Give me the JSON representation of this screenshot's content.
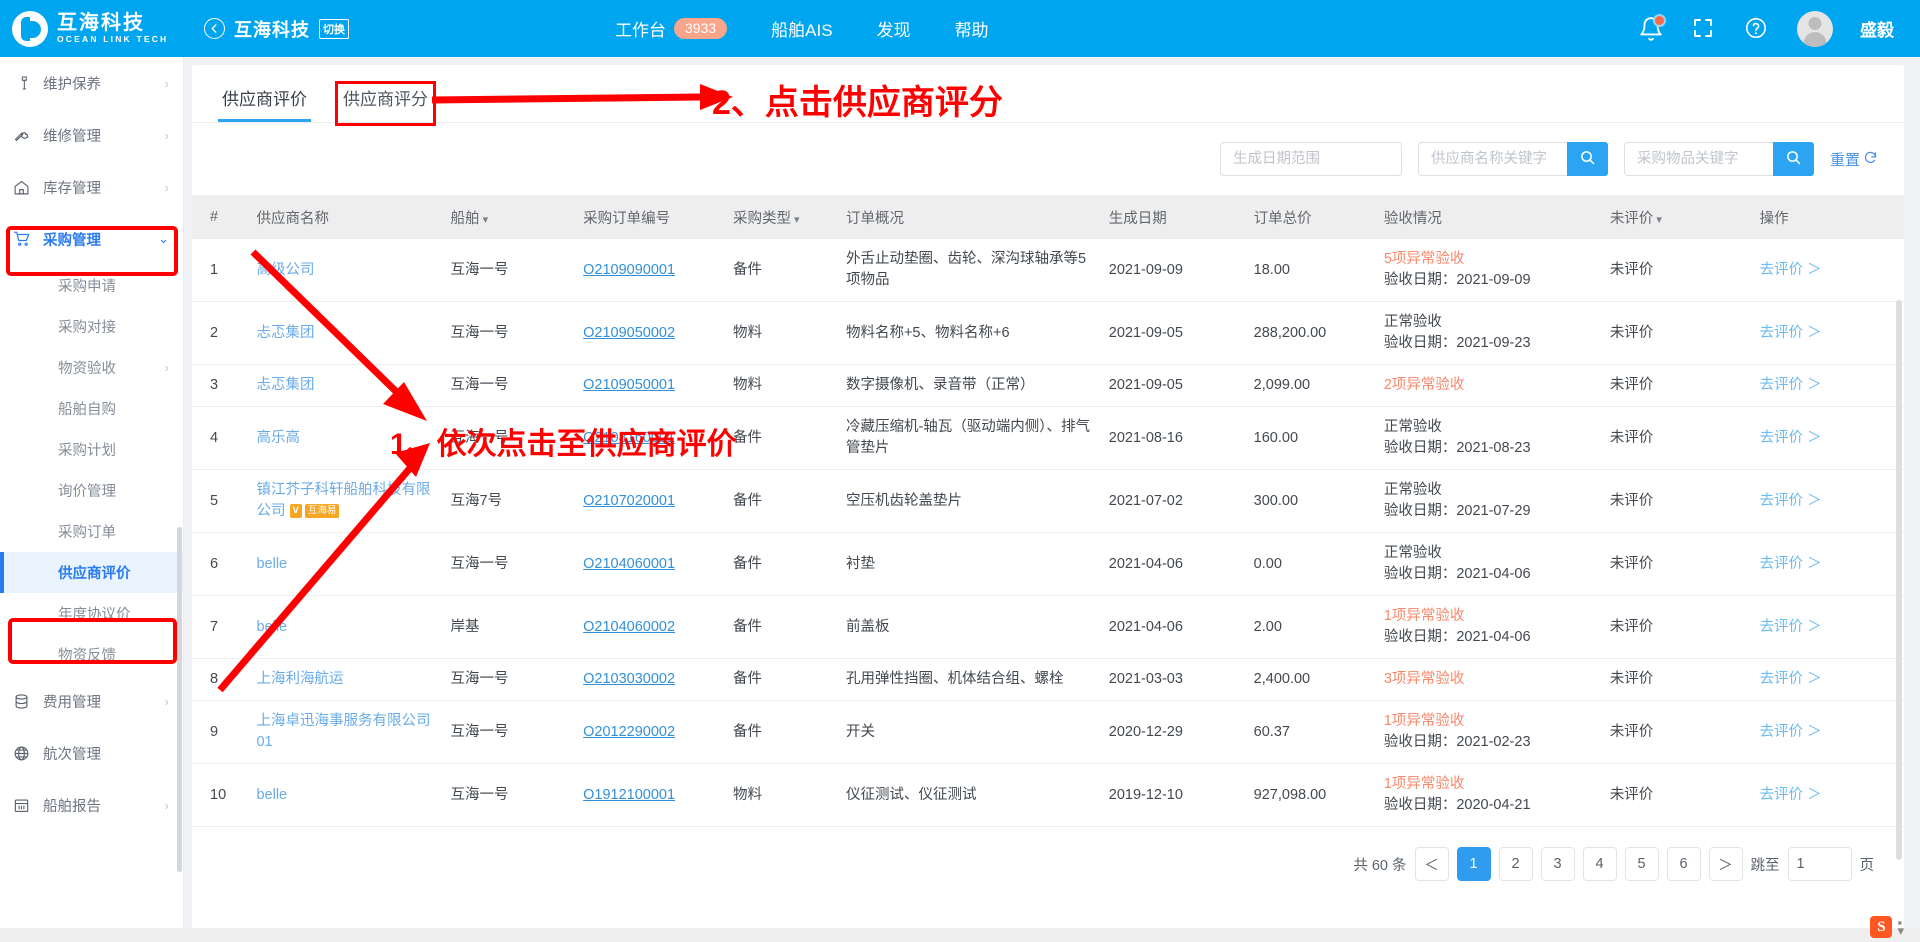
{
  "header": {
    "brand_cn": "互海科技",
    "brand_en": "OCEAN LINK TECH",
    "back_icon": "back-arrow-icon",
    "company": "互海科技",
    "switch_label": "切换",
    "nav": [
      {
        "label": "工作台",
        "badge": "3933"
      },
      {
        "label": "船舶AIS",
        "badge": ""
      },
      {
        "label": "发现",
        "badge": ""
      },
      {
        "label": "帮助",
        "badge": ""
      }
    ],
    "icons": [
      "bell-icon",
      "fullscreen-icon",
      "help-icon"
    ],
    "user_name": "盛毅"
  },
  "sidebar": {
    "items": [
      {
        "label": "维护保养",
        "icon": "hammer-icon",
        "chevron": "›",
        "type": "top"
      },
      {
        "label": "维修管理",
        "icon": "wrench-icon",
        "chevron": "›",
        "type": "top"
      },
      {
        "label": "库存管理",
        "icon": "home-icon",
        "chevron": "›",
        "type": "top"
      },
      {
        "label": "采购管理",
        "icon": "cart-icon",
        "chevron": "⌄",
        "type": "top",
        "active": true
      },
      {
        "label": "采购申请",
        "type": "sub"
      },
      {
        "label": "采购对接",
        "type": "sub"
      },
      {
        "label": "物资验收",
        "type": "sub",
        "chevron": "›"
      },
      {
        "label": "船舶自购",
        "type": "sub"
      },
      {
        "label": "采购计划",
        "type": "sub"
      },
      {
        "label": "询价管理",
        "type": "sub"
      },
      {
        "label": "采购订单",
        "type": "sub"
      },
      {
        "label": "供应商评价",
        "type": "sub",
        "selected": true
      },
      {
        "label": "年度协议价",
        "type": "sub"
      },
      {
        "label": "物资反馈",
        "type": "sub"
      },
      {
        "label": "费用管理",
        "icon": "database-icon",
        "chevron": "›",
        "type": "top"
      },
      {
        "label": "航次管理",
        "icon": "globe-icon",
        "chevron": "",
        "type": "top"
      },
      {
        "label": "船舶报告",
        "icon": "calendar-icon",
        "chevron": "›",
        "type": "top"
      }
    ]
  },
  "tabs": [
    {
      "label": "供应商评价",
      "active": true
    },
    {
      "label": "供应商评分",
      "active": false,
      "highlighted": true
    }
  ],
  "filters": {
    "date_placeholder": "生成日期范围",
    "date_value": "",
    "supplier_placeholder": "供应商名称关键字",
    "supplier_value": "",
    "goods_placeholder": "采购物品关键字",
    "goods_value": "",
    "search_icon": "search-icon",
    "reset_label": "重置",
    "reset_icon": "refresh-icon"
  },
  "table": {
    "columns": [
      {
        "label": "#",
        "sortable": false
      },
      {
        "label": "供应商名称",
        "sortable": false
      },
      {
        "label": "船舶",
        "sortable": true
      },
      {
        "label": "采购订单编号",
        "sortable": false
      },
      {
        "label": "采购类型",
        "sortable": true
      },
      {
        "label": "订单概况",
        "sortable": false
      },
      {
        "label": "生成日期",
        "sortable": false
      },
      {
        "label": "订单总价",
        "sortable": false
      },
      {
        "label": "验收情况",
        "sortable": false
      },
      {
        "label": "未评价",
        "sortable": true
      },
      {
        "label": "操作",
        "sortable": false
      }
    ],
    "rows": [
      {
        "idx": "1",
        "supplier": "高级公司",
        "supplier_tag": "",
        "ship": "互海一号",
        "order_no": "O2109090001",
        "type": "备件",
        "desc": "外舌止动垫圈、齿轮、深沟球轴承等5项物品",
        "date": "2021-09-09",
        "total": "18.00",
        "insp_status": "5项异常验收",
        "insp_abnormal": true,
        "insp_date": "验收日期：2021-09-09",
        "eval": "未评价",
        "action": "去评价 ＞"
      },
      {
        "idx": "2",
        "supplier": "忐忑集团",
        "supplier_tag": "",
        "ship": "互海一号",
        "order_no": "O2109050002",
        "type": "物料",
        "desc": "物料名称+5、物料名称+6",
        "date": "2021-09-05",
        "total": "288,200.00",
        "insp_status": "正常验收",
        "insp_abnormal": false,
        "insp_date": "验收日期：2021-09-23",
        "eval": "未评价",
        "action": "去评价 ＞"
      },
      {
        "idx": "3",
        "supplier": "忐忑集团",
        "supplier_tag": "",
        "ship": "互海一号",
        "order_no": "O2109050001",
        "type": "物料",
        "desc": "数字摄像机、录音带（正常）",
        "date": "2021-09-05",
        "total": "2,099.00",
        "insp_status": "2项异常验收",
        "insp_abnormal": true,
        "insp_date": "",
        "eval": "未评价",
        "action": "去评价 ＞"
      },
      {
        "idx": "4",
        "supplier": "高乐高",
        "supplier_tag": "",
        "ship": "互海一号",
        "order_no": "O2108160001",
        "type": "备件",
        "desc": "冷藏压缩机-轴瓦（驱动端内侧）、排气管垫片",
        "date": "2021-08-16",
        "total": "160.00",
        "insp_status": "正常验收",
        "insp_abnormal": false,
        "insp_date": "验收日期：2021-08-23",
        "eval": "未评价",
        "action": "去评价 ＞"
      },
      {
        "idx": "5",
        "supplier": "镇江芥子科轩船舶科技有限公司",
        "supplier_tag": "互海易",
        "ship": "互海7号",
        "order_no": "O2107020001",
        "type": "备件",
        "desc": "空压机齿轮盖垫片",
        "date": "2021-07-02",
        "total": "300.00",
        "insp_status": "正常验收",
        "insp_abnormal": false,
        "insp_date": "验收日期：2021-07-29",
        "eval": "未评价",
        "action": "去评价 ＞"
      },
      {
        "idx": "6",
        "supplier": "belle",
        "supplier_tag": "",
        "ship": "互海一号",
        "order_no": "O2104060001",
        "type": "备件",
        "desc": "衬垫",
        "date": "2021-04-06",
        "total": "0.00",
        "insp_status": "正常验收",
        "insp_abnormal": false,
        "insp_date": "验收日期：2021-04-06",
        "eval": "未评价",
        "action": "去评价 ＞"
      },
      {
        "idx": "7",
        "supplier": "belle",
        "supplier_tag": "",
        "ship": "岸基",
        "order_no": "O2104060002",
        "type": "备件",
        "desc": "前盖板",
        "date": "2021-04-06",
        "total": "2.00",
        "insp_status": "1项异常验收",
        "insp_abnormal": true,
        "insp_date": "验收日期：2021-04-06",
        "eval": "未评价",
        "action": "去评价 ＞"
      },
      {
        "idx": "8",
        "supplier": "上海利海航运",
        "supplier_tag": "",
        "ship": "互海一号",
        "order_no": "O2103030002",
        "type": "备件",
        "desc": "孔用弹性挡圈、机体结合组、螺栓",
        "date": "2021-03-03",
        "total": "2,400.00",
        "insp_status": "3项异常验收",
        "insp_abnormal": true,
        "insp_date": "",
        "eval": "未评价",
        "action": "去评价 ＞"
      },
      {
        "idx": "9",
        "supplier": "上海卓迅海事服务有限公司01",
        "supplier_tag": "",
        "ship": "互海一号",
        "order_no": "O2012290002",
        "type": "备件",
        "desc": "开关",
        "date": "2020-12-29",
        "total": "60.37",
        "insp_status": "1项异常验收",
        "insp_abnormal": true,
        "insp_date": "验收日期：2021-02-23",
        "eval": "未评价",
        "action": "去评价 ＞"
      },
      {
        "idx": "10",
        "supplier": "belle",
        "supplier_tag": "",
        "ship": "互海一号",
        "order_no": "O1912100001",
        "type": "物料",
        "desc": "仪征测试、仪征测试",
        "date": "2019-12-10",
        "total": "927,098.00",
        "insp_status": "1项异常验收",
        "insp_abnormal": true,
        "insp_date": "验收日期：2020-04-21",
        "eval": "未评价",
        "action": "去评价 ＞"
      }
    ]
  },
  "pagination": {
    "total_label": "共 60 条",
    "prev": "＜",
    "pages": [
      "1",
      "2",
      "3",
      "4",
      "5",
      "6"
    ],
    "current": "1",
    "next": "＞",
    "jump_label": "跳至",
    "jump_value": "1",
    "page_unit": "页"
  },
  "annotations": {
    "step1": "1、依次点击至供应商评价",
    "step2": "2、点击供应商评分"
  },
  "colors": {
    "brand_blue": "#00a5f0",
    "accent_blue": "#2ba5f2",
    "annotation_red": "#ff0000",
    "warn_orange": "#f9886a",
    "badge_salmon": "#f9a58b"
  },
  "watermark": {
    "logo": "sogou-icon"
  }
}
